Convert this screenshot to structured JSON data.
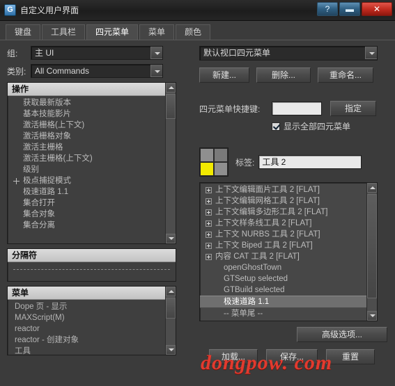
{
  "window": {
    "title": "自定义用户界面",
    "icon": "app-icon-g",
    "help_label": "?",
    "minimize_label": "▬",
    "close_label": "✕"
  },
  "tabs": [
    {
      "label": "键盘",
      "active": false
    },
    {
      "label": "工具栏",
      "active": false
    },
    {
      "label": "四元菜单",
      "active": true
    },
    {
      "label": "菜单",
      "active": false
    },
    {
      "label": "颜色",
      "active": false
    }
  ],
  "left": {
    "group_label": "组:",
    "group_value": "主 UI",
    "category_label": "类别:",
    "category_value": "All Commands",
    "actions_header": "操作",
    "actions": [
      {
        "label": "获取最新版本",
        "icon": "none"
      },
      {
        "label": "基本技能影片",
        "icon": "none"
      },
      {
        "label": "激活栅格(上下文)",
        "icon": "none"
      },
      {
        "label": "激活栅格对象",
        "icon": "none"
      },
      {
        "label": "激活主栅格",
        "icon": "none"
      },
      {
        "label": "激活主栅格(上下文)",
        "icon": "none"
      },
      {
        "label": "级别",
        "icon": "none"
      },
      {
        "label": "极点捕捉模式",
        "icon": "cross"
      },
      {
        "label": "极速道路 1.1",
        "icon": "none"
      },
      {
        "label": "集合打开",
        "icon": "none"
      },
      {
        "label": "集合对象",
        "icon": "none"
      },
      {
        "label": "集合分离",
        "icon": "none"
      }
    ],
    "separator_header": "分隔符",
    "menu_header": "菜单",
    "menus": [
      {
        "label": "Dope 页 - 显示"
      },
      {
        "label": "MAXScript(M)"
      },
      {
        "label": "reactor"
      },
      {
        "label": "reactor - 创建对象"
      },
      {
        "label": "工具"
      }
    ]
  },
  "right": {
    "quad_set_value": "默认视口四元菜单",
    "new_button": "新建...",
    "delete_button": "删除...",
    "rename_button": "重命名...",
    "shortcut_label": "四元菜单快捷键:",
    "shortcut_value": "",
    "assign_button": "指定",
    "show_all_checkbox": "显示全部四元菜单",
    "show_all_checked": true,
    "label_label": "标签:",
    "label_value": "工具 2",
    "quad_colors": {
      "top_left": "#8f8f8f",
      "top_right": "#7a7a7a",
      "bottom_left": "#f2ea00",
      "bottom_right": "#8f8f8f"
    },
    "menu_items": [
      {
        "label": "上下文编辑面片工具 2 [FLAT]",
        "icon": "plusbox",
        "state": "normal"
      },
      {
        "label": "上下文编辑网格工具 2 [FLAT]",
        "icon": "plusbox",
        "state": "normal"
      },
      {
        "label": "上下文编辑多边形工具 2 [FLAT]",
        "icon": "plusbox",
        "state": "normal"
      },
      {
        "label": "上下文样条线工具 2 [FLAT]",
        "icon": "plusbox",
        "state": "normal"
      },
      {
        "label": "上下文 NURBS 工具 2 [FLAT]",
        "icon": "plusbox",
        "state": "normal"
      },
      {
        "label": "上下文 Biped 工具 2 [FLAT]",
        "icon": "plusbox",
        "state": "normal"
      },
      {
        "label": "内容 CAT 工具 2 [FLAT]",
        "icon": "plusbox",
        "state": "normal"
      },
      {
        "label": "openGhostTown",
        "icon": "none",
        "state": "normal"
      },
      {
        "label": "GTSetup selected",
        "icon": "none",
        "state": "normal"
      },
      {
        "label": "GTBuild selected",
        "icon": "none",
        "state": "normal"
      },
      {
        "label": "极速道路 1.1",
        "icon": "none",
        "state": "selected"
      },
      {
        "label": "-- 菜单尾 --",
        "icon": "none",
        "state": "normal"
      }
    ],
    "advanced_button": "高级选项...",
    "load_button": "加载...",
    "save_button": "保存...",
    "reset_button": "重置"
  },
  "watermark": "dongpow. com"
}
